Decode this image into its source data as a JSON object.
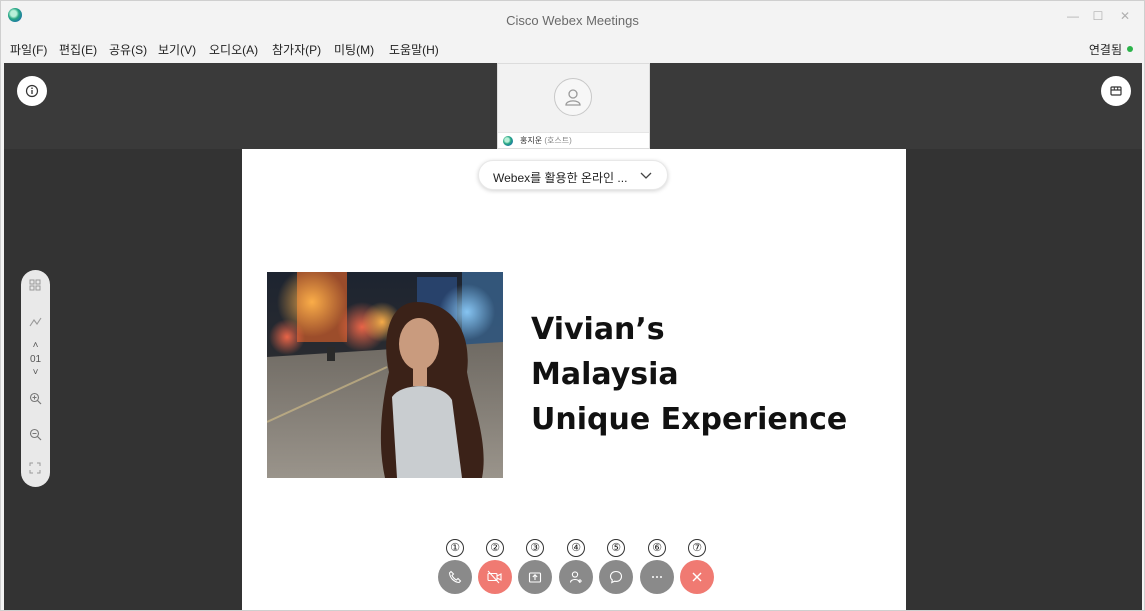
{
  "window": {
    "title": "Cisco Webex Meetings",
    "minimize_glyph": "—",
    "maximize_glyph": "☐",
    "close_glyph": "✕"
  },
  "menu": [
    {
      "label": "파일(F)"
    },
    {
      "label": "편집(E)"
    },
    {
      "label": "공유(S)"
    },
    {
      "label": "보기(V)"
    },
    {
      "label": "오디오(A)"
    },
    {
      "label": "참가자(P)"
    },
    {
      "label": "미팅(M)"
    },
    {
      "label": "도움말(H)"
    }
  ],
  "connection": {
    "status": "연결됨",
    "status_color": "#2bb34a"
  },
  "host": {
    "name": "홍지운",
    "role": "(호스트)",
    "icon": "person-icon"
  },
  "document": {
    "name": "Webex를 활용한 온라인 ..."
  },
  "slide": {
    "lines": [
      "Vivian’s",
      "Malaysia",
      "Unique Experience"
    ]
  },
  "page_toolbar": {
    "page_number": "01"
  },
  "controls": [
    {
      "number": "①",
      "icon": "phone-icon",
      "color": "#8a8a8a"
    },
    {
      "number": "②",
      "icon": "video-off-icon",
      "color": "#f07a72"
    },
    {
      "number": "③",
      "icon": "share-icon",
      "color": "#8a8a8a"
    },
    {
      "number": "④",
      "icon": "participants-icon",
      "color": "#8a8a8a"
    },
    {
      "number": "⑤",
      "icon": "chat-icon",
      "color": "#8a8a8a"
    },
    {
      "number": "⑥",
      "icon": "more-icon",
      "color": "#8a8a8a"
    },
    {
      "number": "⑦",
      "icon": "leave-icon",
      "color": "#f07a72"
    }
  ]
}
